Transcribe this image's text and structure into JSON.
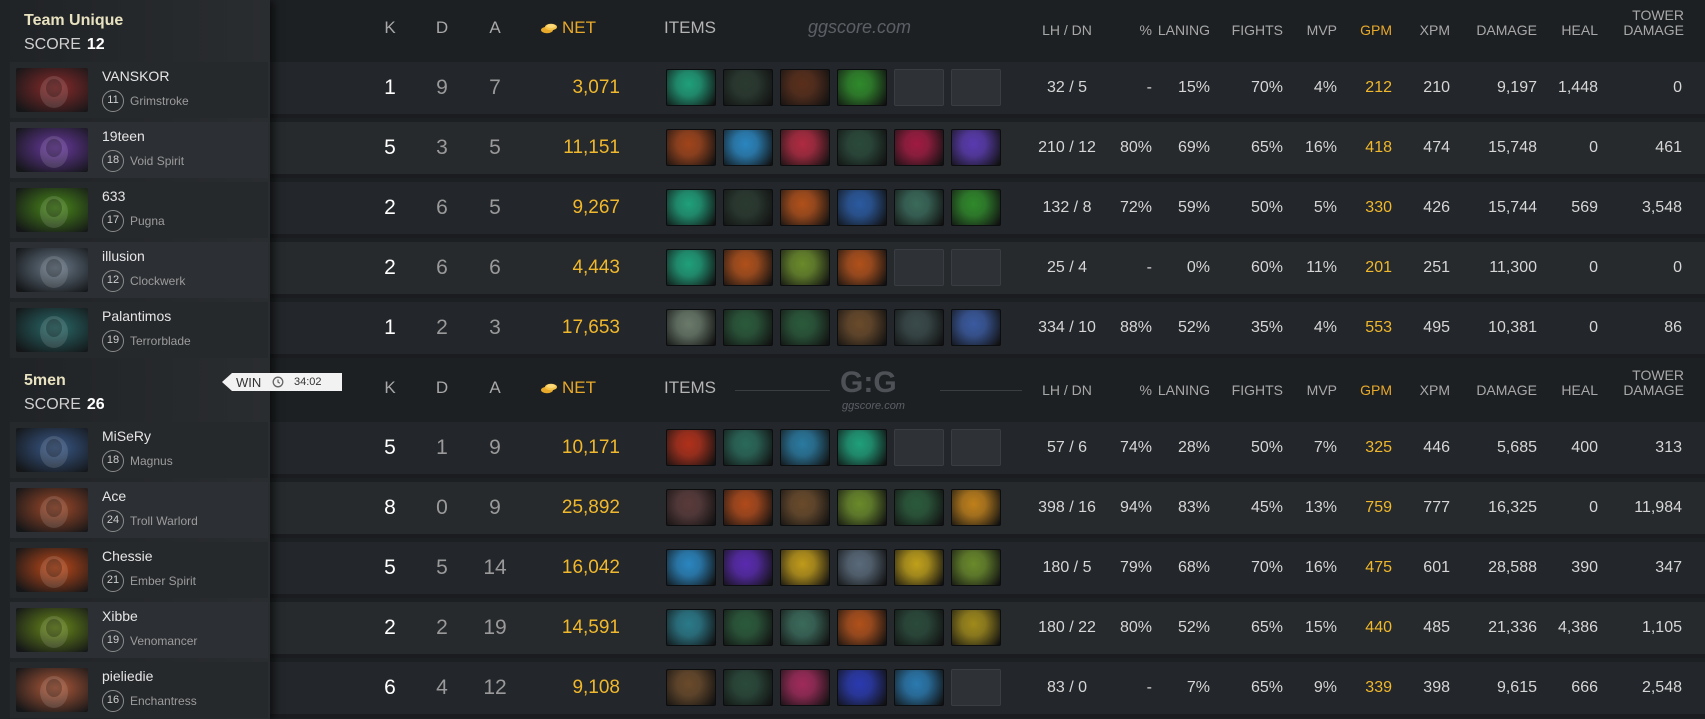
{
  "headers": {
    "k": "K",
    "d": "D",
    "a": "A",
    "net": "NET",
    "items": "ITEMS",
    "lh_dn": "LH / DN",
    "pct": "%",
    "laning": "LANING",
    "fights": "FIGHTS",
    "mvp": "MVP",
    "gpm": "GPM",
    "xpm": "XPM",
    "damage": "DAMAGE",
    "heal": "HEAL",
    "tower_damage": "TOWER DAMAGE"
  },
  "watermarks": {
    "top": "ggscore.com",
    "logo": "G:G",
    "logo_sub": "ggscore.com"
  },
  "win_badge": {
    "label": "WIN",
    "time": "34:02"
  },
  "teams": [
    {
      "name": "Team Unique",
      "score_label": "SCORE",
      "score": "12",
      "players": [
        {
          "name": "VANSKOR",
          "level": "11",
          "hero": "Grimstroke",
          "k": "1",
          "d": "9",
          "a": "7",
          "net": "3,071",
          "lh_dn": "32 / 5",
          "pct": "-",
          "laning": "15%",
          "fights": "70%",
          "mvp": "4%",
          "gpm": "212",
          "xpm": "210",
          "damage": "9,197",
          "heal": "1,448",
          "tower": "0",
          "hero_color": "#8a2b2b",
          "items": [
            "#1fa07a",
            "#2a3a30",
            "#5a2e1a",
            "#2f8a2a",
            "",
            ""
          ]
        },
        {
          "name": "19teen",
          "level": "18",
          "hero": "Void Spirit",
          "k": "5",
          "d": "3",
          "a": "5",
          "net": "11,151",
          "lh_dn": "210 / 12",
          "pct": "80%",
          "laning": "69%",
          "fights": "65%",
          "mvp": "16%",
          "gpm": "418",
          "xpm": "474",
          "damage": "15,748",
          "heal": "0",
          "tower": "461",
          "hero_color": "#6a3aa0",
          "items": [
            "#a0441a",
            "#2a86c0",
            "#b02a40",
            "#2a4a3a",
            "#a01a40",
            "#5a3ab0"
          ]
        },
        {
          "name": "633",
          "level": "17",
          "hero": "Pugna",
          "k": "2",
          "d": "6",
          "a": "5",
          "net": "9,267",
          "lh_dn": "132 / 8",
          "pct": "72%",
          "laning": "59%",
          "fights": "50%",
          "mvp": "5%",
          "gpm": "330",
          "xpm": "426",
          "damage": "15,744",
          "heal": "569",
          "tower": "3,548",
          "hero_color": "#4a8a1a",
          "items": [
            "#1fa07a",
            "#2a3a30",
            "#b0501a",
            "#2a5aa0",
            "#3a6a5a",
            "#2f8a2a"
          ]
        },
        {
          "name": "illusion",
          "level": "12",
          "hero": "Clockwerk",
          "k": "2",
          "d": "6",
          "a": "6",
          "net": "4,443",
          "lh_dn": "25 / 4",
          "pct": "-",
          "laning": "0%",
          "fights": "60%",
          "mvp": "11%",
          "gpm": "201",
          "xpm": "251",
          "damage": "11,300",
          "heal": "0",
          "tower": "0",
          "hero_color": "#6a7a8a",
          "items": [
            "#1fa07a",
            "#b0501a",
            "#6a8a2a",
            "#b0501a",
            "",
            ""
          ]
        },
        {
          "name": "Palantimos",
          "level": "19",
          "hero": "Terrorblade",
          "k": "1",
          "d": "2",
          "a": "3",
          "net": "17,653",
          "lh_dn": "334 / 10",
          "pct": "88%",
          "laning": "52%",
          "fights": "35%",
          "mvp": "4%",
          "gpm": "553",
          "xpm": "495",
          "damage": "10,381",
          "heal": "0",
          "tower": "86",
          "hero_color": "#2a6a6a",
          "items": [
            "#6a7a6a",
            "#2a5a3a",
            "#2a5a3a",
            "#6a4a2a",
            "#3a4a4a",
            "#3a5aa0"
          ]
        }
      ]
    },
    {
      "name": "5men",
      "score_label": "SCORE",
      "score": "26",
      "players": [
        {
          "name": "MiSeRy",
          "level": "18",
          "hero": "Magnus",
          "k": "5",
          "d": "1",
          "a": "9",
          "net": "10,171",
          "lh_dn": "57 / 6",
          "pct": "74%",
          "laning": "28%",
          "fights": "50%",
          "mvp": "7%",
          "gpm": "325",
          "xpm": "446",
          "damage": "5,685",
          "heal": "400",
          "tower": "313",
          "hero_color": "#3a5a8a",
          "items": [
            "#b0301a",
            "#2a6a5a",
            "#2a7aa0",
            "#1fa07a",
            "",
            ""
          ]
        },
        {
          "name": "Ace",
          "level": "24",
          "hero": "Troll Warlord",
          "k": "8",
          "d": "0",
          "a": "9",
          "net": "25,892",
          "lh_dn": "398 / 16",
          "pct": "94%",
          "laning": "83%",
          "fights": "45%",
          "mvp": "13%",
          "gpm": "759",
          "xpm": "777",
          "damage": "16,325",
          "heal": "0",
          "tower": "11,984",
          "hero_color": "#a04a2a",
          "items": [
            "#5a3a3a",
            "#b04a1a",
            "#6a4a2a",
            "#6a8a2a",
            "#2a5a3a",
            "#c0801a"
          ]
        },
        {
          "name": "Chessie",
          "level": "21",
          "hero": "Ember Spirit",
          "k": "5",
          "d": "5",
          "a": "14",
          "net": "16,042",
          "lh_dn": "180 / 5",
          "pct": "79%",
          "laning": "68%",
          "fights": "70%",
          "mvp": "16%",
          "gpm": "475",
          "xpm": "601",
          "damage": "28,588",
          "heal": "390",
          "tower": "347",
          "hero_color": "#c04a1a",
          "items": [
            "#2a86c0",
            "#5a2ab0",
            "#c09a1a",
            "#5a6a7a",
            "#c0a01a",
            "#6a8a2a"
          ]
        },
        {
          "name": "Xibbe",
          "level": "19",
          "hero": "Venomancer",
          "k": "2",
          "d": "2",
          "a": "19",
          "net": "14,591",
          "lh_dn": "180 / 22",
          "pct": "80%",
          "laning": "52%",
          "fights": "65%",
          "mvp": "15%",
          "gpm": "440",
          "xpm": "485",
          "damage": "21,336",
          "heal": "4,386",
          "tower": "1,105",
          "hero_color": "#6a8a1a",
          "items": [
            "#2a7a8a",
            "#2a5a3a",
            "#3a6a5a",
            "#b0501a",
            "#2a4a3a",
            "#a08a1a"
          ]
        },
        {
          "name": "pieliedie",
          "level": "16",
          "hero": "Enchantress",
          "k": "6",
          "d": "4",
          "a": "12",
          "net": "9,108",
          "lh_dn": "83 / 0",
          "pct": "-",
          "laning": "7%",
          "fights": "65%",
          "mvp": "9%",
          "gpm": "339",
          "xpm": "398",
          "damage": "9,615",
          "heal": "666",
          "tower": "2,548",
          "hero_color": "#b05a3a",
          "items": [
            "#6a4a2a",
            "#2a4a3a",
            "#a02a5a",
            "#2a3ab0",
            "#2a7ab0",
            ""
          ]
        }
      ]
    }
  ]
}
